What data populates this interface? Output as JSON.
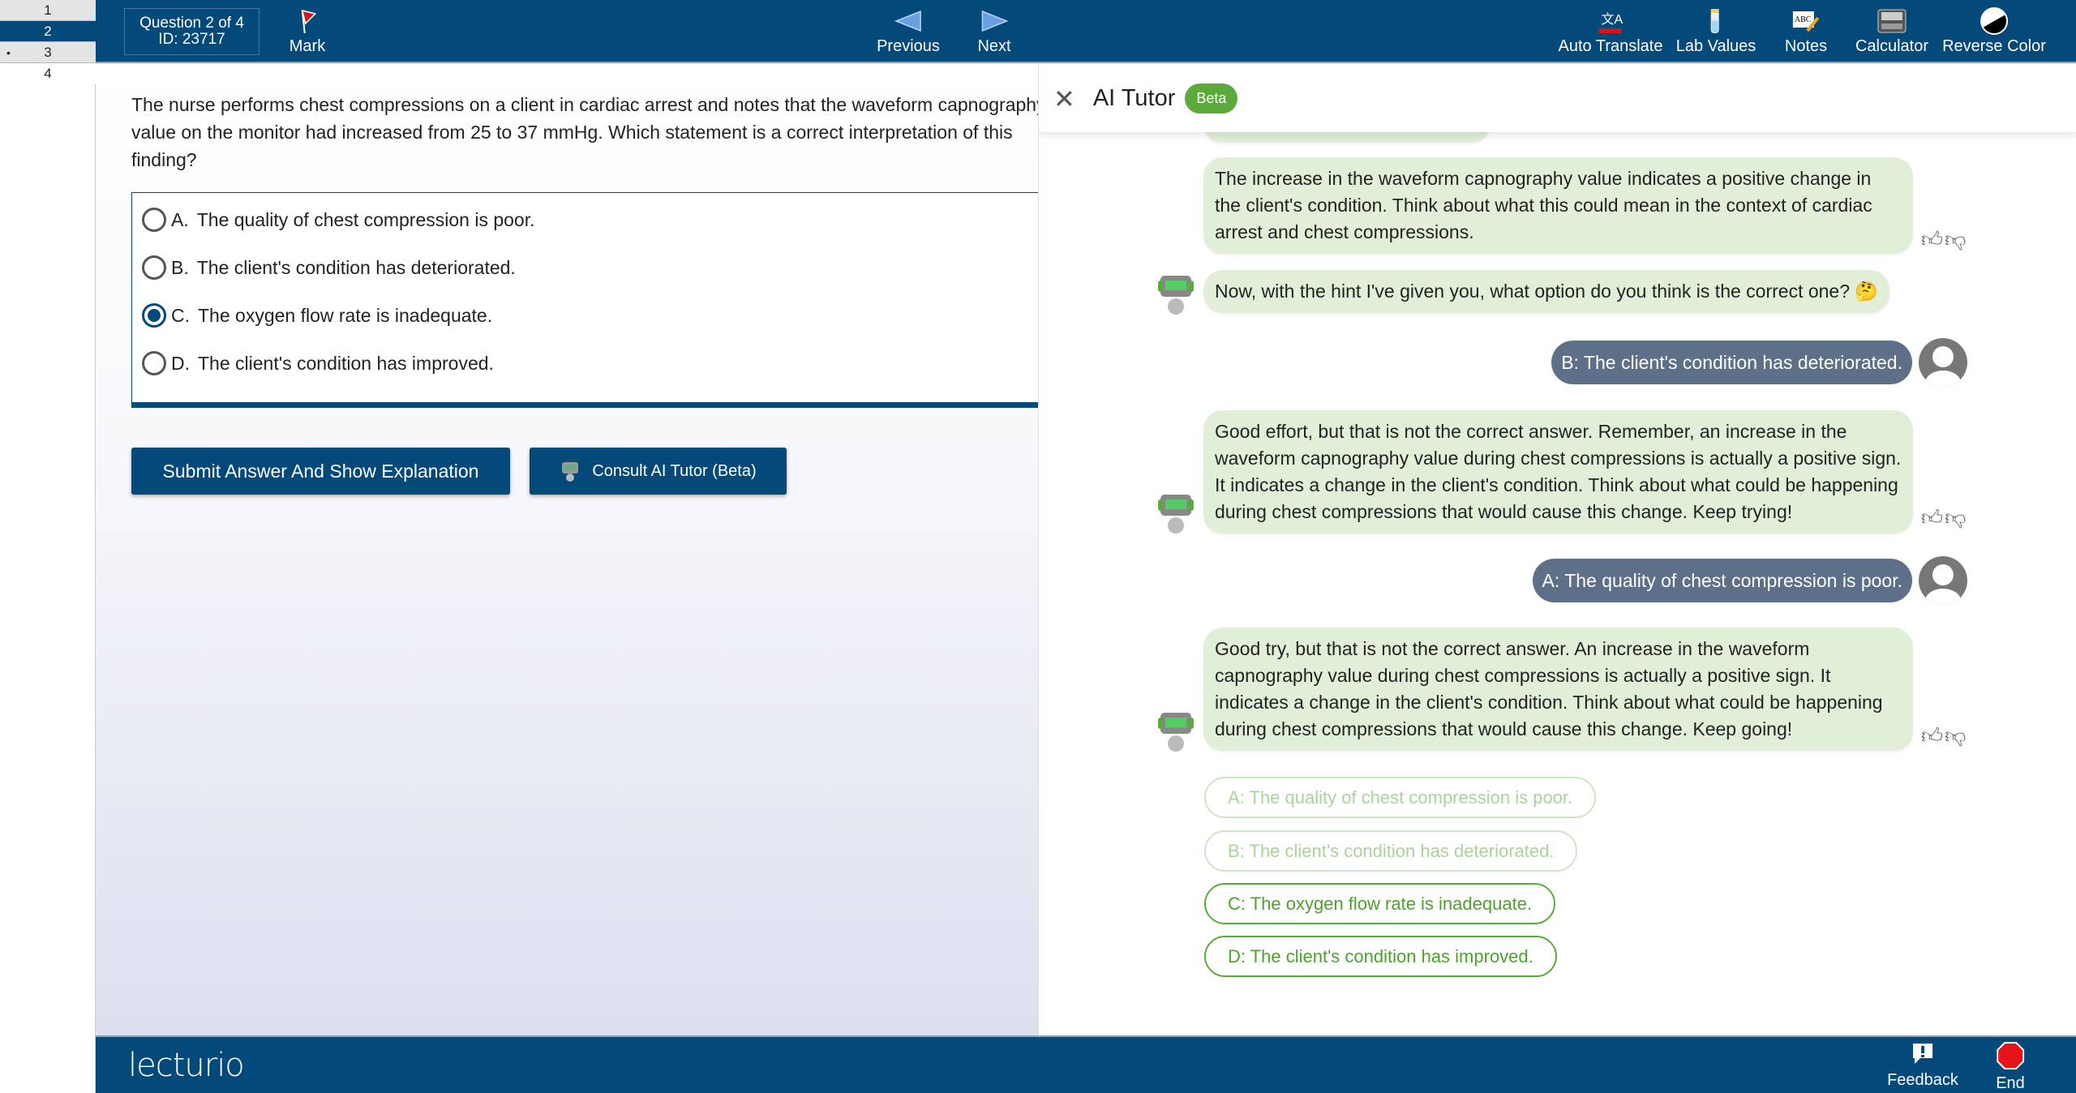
{
  "sidebar": {
    "questions": [
      "1",
      "2",
      "3",
      "4"
    ],
    "active": "2",
    "marked_dot": "•"
  },
  "topbar": {
    "question_info": "Question 2 of 4",
    "question_id": "ID: 23717",
    "mark": "Mark",
    "previous": "Previous",
    "next": "Next",
    "tools": [
      {
        "label": "Auto Translate",
        "icon": "translate-icon"
      },
      {
        "label": "Lab Values",
        "icon": "lab-flask-icon"
      },
      {
        "label": "Notes",
        "icon": "notes-icon"
      },
      {
        "label": "Calculator",
        "icon": "calculator-icon"
      },
      {
        "label": "Reverse Color",
        "icon": "contrast-icon"
      }
    ]
  },
  "question": {
    "lines": [
      "The nurse performs chest compressions on a client in cardiac arrest and notes that the waveform capnography",
      "value on the monitor had increased from 25 to 37 mmHg. Which statement is a correct interpretation of this",
      "finding?"
    ],
    "options": [
      {
        "letter": "A.",
        "text": "The quality of chest compression is poor.",
        "selected": false
      },
      {
        "letter": "B.",
        "text": "The client's condition has deteriorated.",
        "selected": false
      },
      {
        "letter": "C.",
        "text": "The oxygen flow rate is inadequate.",
        "selected": true
      },
      {
        "letter": "D.",
        "text": "The client's condition has improved.",
        "selected": false
      }
    ],
    "submit": "Submit Answer And Show Explanation",
    "consult": "Consult AI Tutor (Beta)"
  },
  "tutor": {
    "title": "AI Tutor",
    "badge": "Beta",
    "messages": [
      {
        "from": "bot",
        "text": "The increase in the waveform capnography value indicates a positive change in the client's condition. Think about what this could mean in the context of cardiac arrest and chest compressions."
      },
      {
        "from": "bot",
        "text": "Now, with the hint I've given you, what option do you think is the correct one? 🤔"
      },
      {
        "from": "user",
        "text": "B: The client's condition has deteriorated."
      },
      {
        "from": "bot",
        "text": "Good effort, but that is not the correct answer. Remember, an increase in the waveform capnography value during chest compressions is actually a positive sign. It indicates a change in the client's condition. Think about what could be happening during chest compressions that would cause this change. Keep trying!"
      },
      {
        "from": "user",
        "text": "A: The quality of chest compression is poor."
      },
      {
        "from": "bot",
        "text": "Good try, but that is not the correct answer. An increase in the waveform capnography value during chest compressions is actually a positive sign. It indicates a change in the client's condition. Think about what could be happening during chest compressions that would cause this change. Keep going!"
      }
    ],
    "choices": [
      {
        "text": "A: The quality of chest compression is poor.",
        "enabled": false
      },
      {
        "text": "B: The client's condition has deteriorated.",
        "enabled": false
      },
      {
        "text": "C: The oxygen flow rate is inadequate.",
        "enabled": true
      },
      {
        "text": "D: The client's condition has improved.",
        "enabled": true
      }
    ]
  },
  "footer": {
    "logo": "lecturio",
    "feedback": "Feedback",
    "end": "End"
  },
  "colors": {
    "brand": "#03497a",
    "bot_bubble": "#e1efd9",
    "user_bubble": "#5e6f88",
    "accent_green": "#5aaa3c",
    "end_red": "#e8141b"
  }
}
